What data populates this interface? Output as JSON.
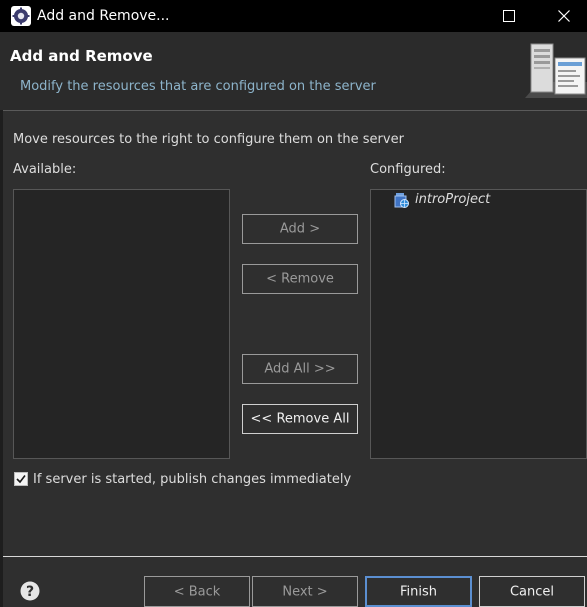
{
  "window": {
    "title": "Add and Remove..."
  },
  "header": {
    "title": "Add and Remove",
    "description": "Modify the resources that are configured on the server"
  },
  "body": {
    "instruction": "Move resources to the right to configure them on the server",
    "available_label": "Available:",
    "configured_label": "Configured:",
    "available_items": [],
    "configured_items": [
      {
        "label": "introProject",
        "icon": "web-project-icon"
      }
    ]
  },
  "actions": {
    "add": "Add >",
    "remove": "< Remove",
    "add_all": "Add All >>",
    "remove_all": "<< Remove All"
  },
  "options": {
    "publish_immediately_label": "If server is started, publish changes immediately",
    "publish_immediately_checked": true
  },
  "footer": {
    "back": "< Back",
    "next": "Next >",
    "finish": "Finish",
    "cancel": "Cancel"
  },
  "colors": {
    "background": "#2f2f2f",
    "titlebar": "#000000",
    "header_description": "#8db4cb",
    "default_button_border": "#5b8fd1"
  }
}
